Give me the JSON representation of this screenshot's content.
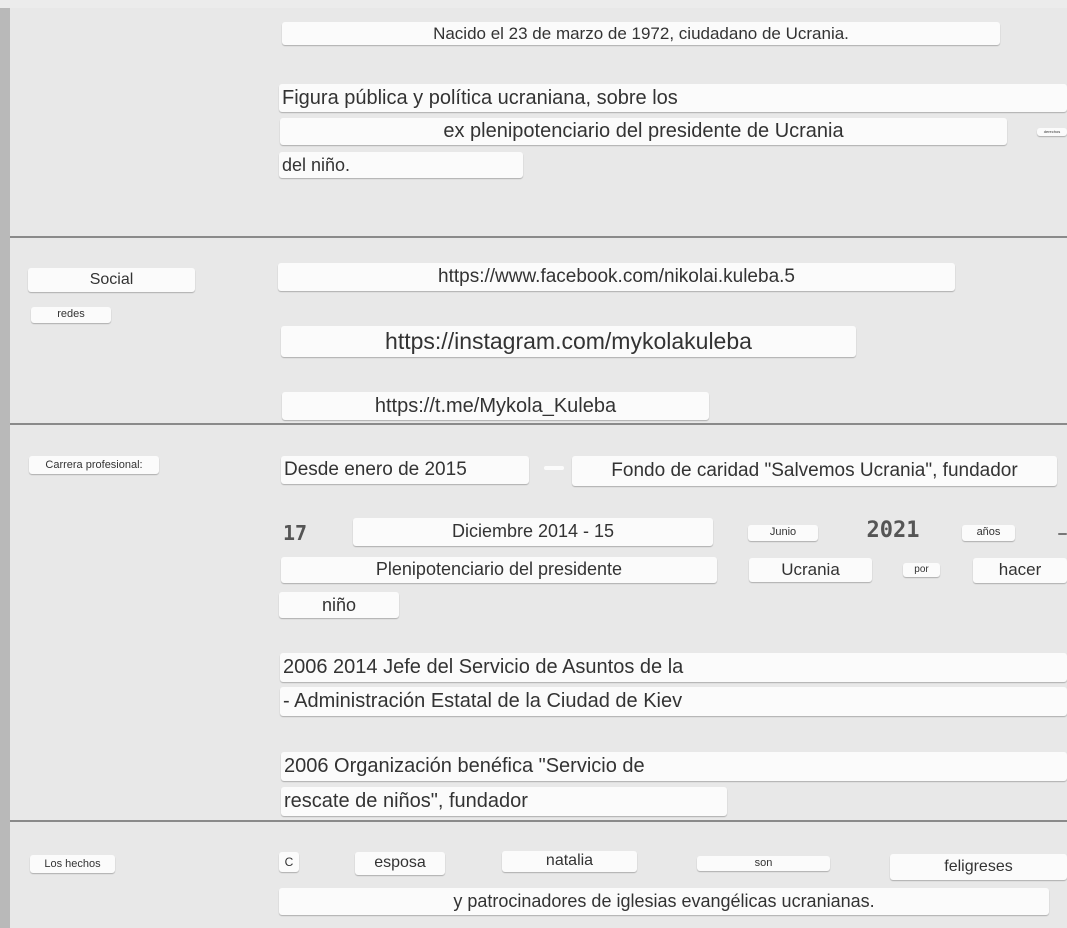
{
  "intro": {
    "birth": "Nacido el 23 de marzo de 1972, ciudadano de Ucrania.",
    "bio_line1": "Figura pública y política ucraniana, sobre los",
    "bio_line2": "ex plenipotenciario del presidente de Ucrania",
    "bio_side": "derechos",
    "bio_line3": "del niño."
  },
  "social": {
    "label_line1": "Social",
    "label_line2": "redes",
    "links": [
      "https://www.facebook.com/nikolai.kuleba.5",
      "https://instagram.com/mykolakuleba",
      "https://t.me/Mykola_Kuleba"
    ]
  },
  "career": {
    "label": "Carrera profesional:",
    "entry1_date": "Desde enero de 2015",
    "entry1_text": "Fondo de caridad \"Salvemos Ucrania\", fundador",
    "entry2_day": "17",
    "entry2_range": "Diciembre 2014 - 15",
    "entry2_month": "Junio",
    "entry2_year": "2021",
    "entry2_years_word": "años",
    "entry2_role": "Plenipotenciario del presidente",
    "entry2_country": "Ucrania",
    "entry2_por": "por",
    "entry2_hacer": "hacer",
    "entry2_nino": "niño",
    "entry3_line1": "2006 2014 Jefe del Servicio de Asuntos de la",
    "entry3_line2": "- Administración Estatal de la Ciudad de Kiev",
    "entry4_line1": "2006 Organización benéfica \"Servicio de",
    "entry4_line2": "rescate de niños\", fundador"
  },
  "facts": {
    "label": "Los hechos",
    "w_c": "C",
    "w_esposa": "esposa",
    "w_natalia": "natalia",
    "w_son": "son",
    "w_feligreses": "feligreses",
    "line2": "y patrocinadores de iglesias evangélicas ucranianas."
  }
}
